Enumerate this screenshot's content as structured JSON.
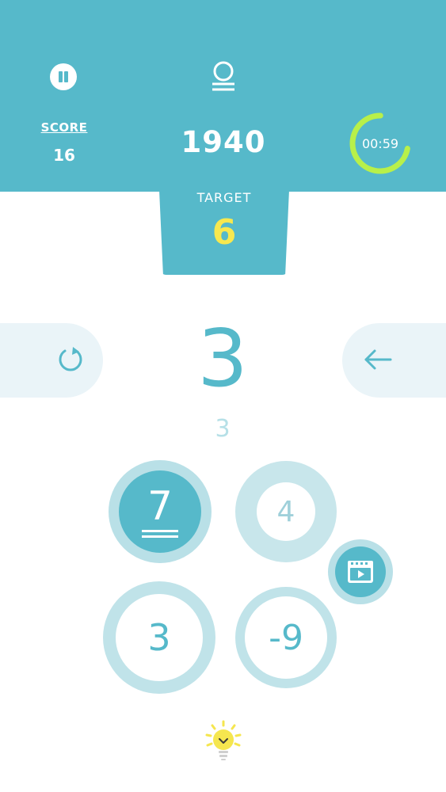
{
  "header": {
    "score_label": "SCORE",
    "score_value": "16",
    "points": "1940",
    "timer_text": "00:59",
    "timer_progress": 0.72
  },
  "target": {
    "label": "TARGET",
    "value": "6"
  },
  "board": {
    "current_value": "3",
    "expression": "3"
  },
  "tiles": [
    {
      "value": "7",
      "state": "selected"
    },
    {
      "value": "4",
      "state": "used"
    },
    {
      "value": "3",
      "state": "available"
    },
    {
      "value": "-9",
      "state": "available"
    }
  ],
  "colors": {
    "primary": "#56b9ca",
    "tile_ring": "#c0e3e9",
    "panel": "#eaf4f8",
    "target_number": "#f7e84f",
    "timer_ring": "#b8f04a",
    "hint_bulb": "#f5e64f"
  },
  "icons": {
    "pause": "pause-icon",
    "coins": "coin-stack-icon",
    "reset": "reset-icon",
    "back": "arrow-left-icon",
    "video": "video-icon",
    "hint": "lightbulb-icon"
  }
}
